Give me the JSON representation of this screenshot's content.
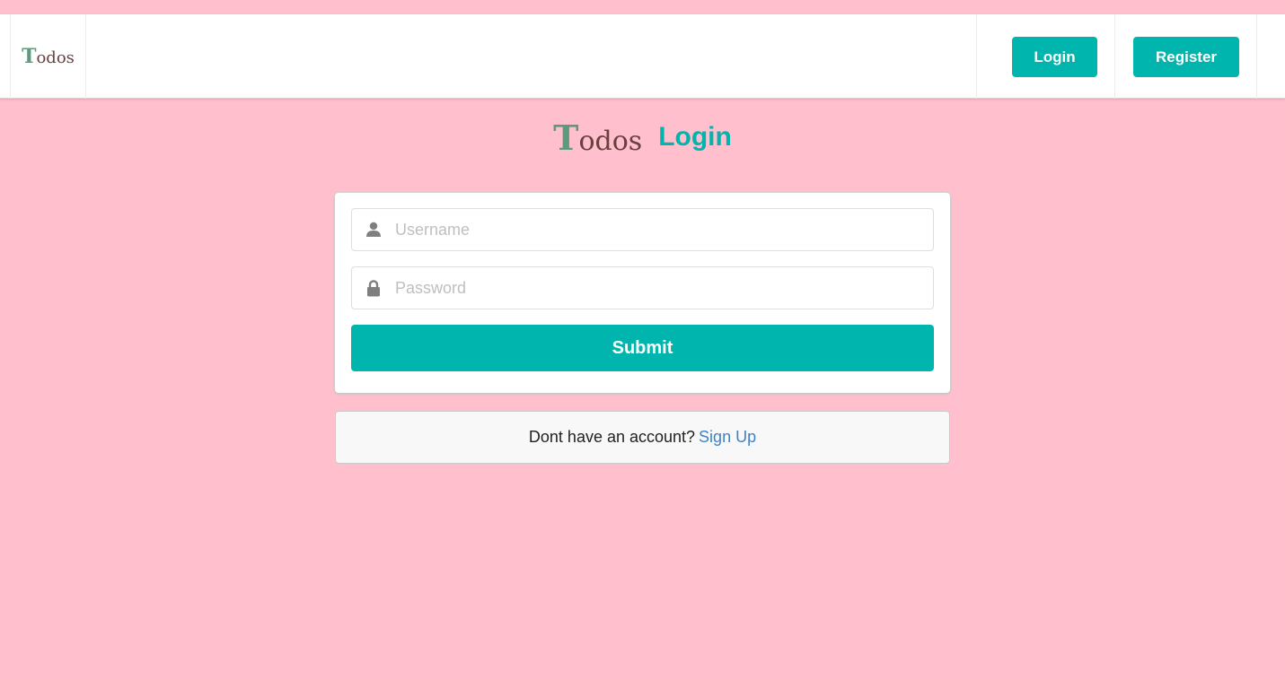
{
  "app": {
    "logo_first": "T",
    "logo_rest": "odos"
  },
  "nav": {
    "login_label": "Login",
    "register_label": "Register"
  },
  "header": {
    "title": "Login"
  },
  "form": {
    "username": {
      "icon": "user-icon",
      "placeholder": "Username",
      "value": ""
    },
    "password": {
      "icon": "lock-icon",
      "placeholder": "Password",
      "value": ""
    },
    "submit_label": "Submit"
  },
  "footer": {
    "prompt": "Dont have an account?",
    "signup_label": "Sign Up"
  },
  "colors": {
    "page_background": "#ffbfcc",
    "accent": "#00b5ad",
    "link": "#4183c4",
    "logo_t": "#5b9a7c",
    "logo_rest": "#6b3f3f"
  }
}
